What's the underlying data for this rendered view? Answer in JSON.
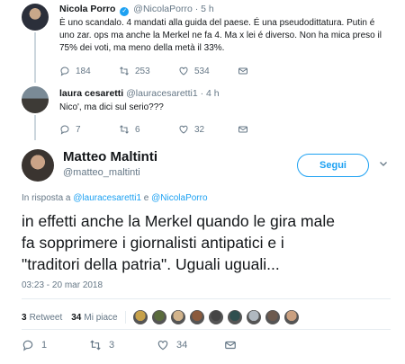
{
  "tweets_above": [
    {
      "name": "Nicola Porro",
      "handle": "@NicolaPorro",
      "time": "· 5 h",
      "text_lines": [
        "È uno scandalo. 4 mandati alla guida del paese. É una pseudodittatura. Putin é",
        "uno zar. ops ma anche la Merkel ne fa 4. Ma x lei é diverso. Non ha mica preso il",
        "75% dei voti, ma meno della metà il 33%."
      ],
      "replies": "184",
      "retweets": "253",
      "likes": "534"
    },
    {
      "name": "laura cesaretti",
      "handle": "@lauracesaretti1",
      "time": "· 4 h",
      "text_lines": [
        "Nico', ma dici sul serio???"
      ],
      "replies": "7",
      "retweets": "6",
      "likes": "32"
    }
  ],
  "main_tweet": {
    "name": "Matteo Maltinti",
    "handle": "@matteo_maltinti",
    "follow_label": "Segui",
    "replying_prefix": "In risposta a",
    "replying_user1": "@lauracesaretti1",
    "replying_and": "e",
    "replying_user2": "@NicolaPorro",
    "text_lines": [
      "in effetti anche la Merkel quando le gira male",
      "fa sopprimere i giornalisti antipatici e i",
      "\"traditori della patria\". Uguali uguali..."
    ],
    "timestamp": "03:23 - 20 mar 2018",
    "retweet_count": "3",
    "retweet_label": "Retweet",
    "like_count": "34",
    "like_label": "Mi piace",
    "reply_count": "1",
    "retweet_action_count": "3",
    "like_action_count": "34"
  },
  "liker_avatar_colors": [
    "#c7a14a",
    "#5a6b3c",
    "#d2b48c",
    "#8b5a3c",
    "#444444",
    "#2f4f4f",
    "#b0b8c0",
    "#6d5a4e",
    "#caa080"
  ],
  "icons": [
    "reply-icon",
    "retweet-icon",
    "like-icon",
    "dm-icon",
    "verified-icon",
    "chevron-down-icon"
  ],
  "colors": {
    "accent": "#1da1f2",
    "muted": "#657786",
    "text": "#14171a"
  }
}
